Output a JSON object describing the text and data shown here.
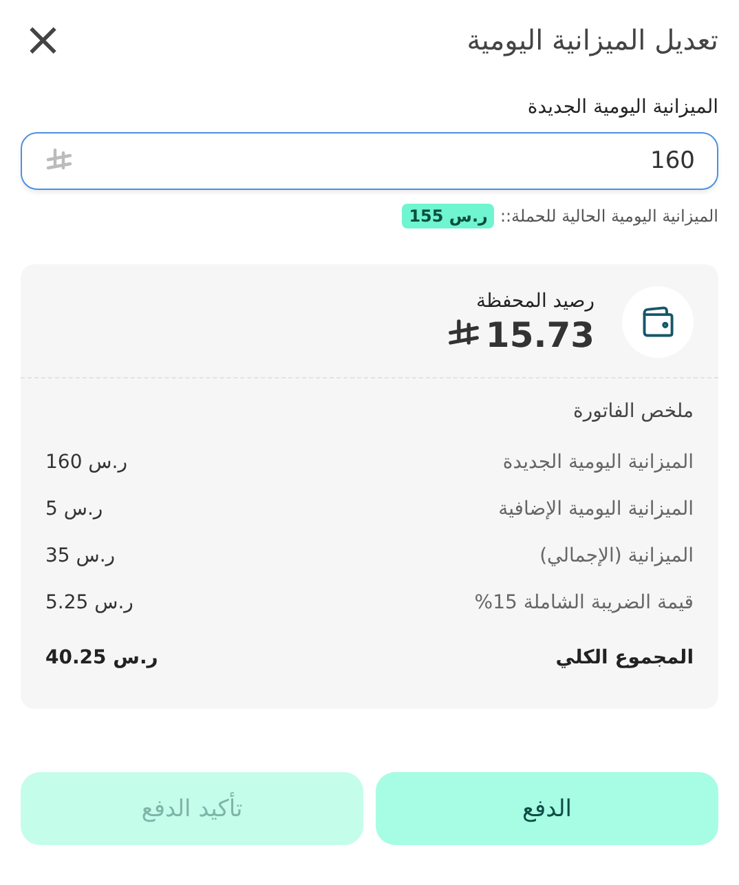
{
  "header": {
    "title": "تعديل الميزانية اليومية",
    "close": "×"
  },
  "budget_field": {
    "label": "الميزانية اليومية الجديدة",
    "value": "160",
    "hint": "الميزانية اليومية الحالية للحملة::",
    "current_badge": "155 ر.س"
  },
  "wallet": {
    "label": "رصيد المحفظة",
    "amount": "15.73"
  },
  "invoice": {
    "title": "ملخص الفاتورة",
    "rows": [
      {
        "kind": "line",
        "label": "الميزانية اليومية الجديدة",
        "value": "160 ر.س"
      },
      {
        "kind": "line",
        "label": "الميزانية اليومية الإضافية",
        "value": "5 ر.س"
      },
      {
        "kind": "line",
        "label": "الميزانية (الإجمالي)",
        "value": "35 ر.س"
      },
      {
        "kind": "line",
        "label": "قيمة الضريبة الشاملة 15%",
        "value": "5.25 ر.س"
      },
      {
        "kind": "total",
        "label": "المجموع الكلي",
        "value": "40.25 ر.س"
      }
    ]
  },
  "buttons": [
    {
      "label": "الدفع",
      "disabled": false
    },
    {
      "label": "تأكيد الدفع",
      "disabled": true
    }
  ]
}
